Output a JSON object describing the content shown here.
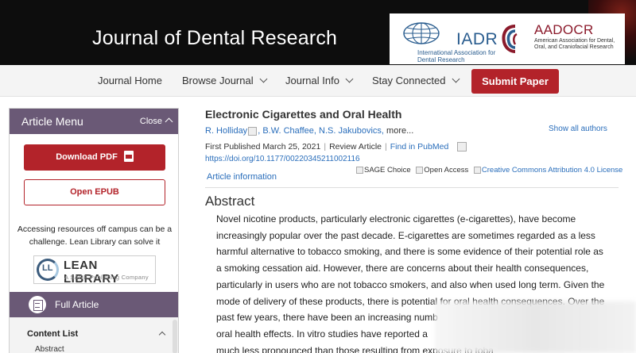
{
  "header": {
    "journal_title": "Journal of Dental Research",
    "iadr": {
      "name": "IADR",
      "subtitle": "International Association for Dental Research"
    },
    "aadocr": {
      "name": "AADOCR",
      "subtitle": "American Association for Dental, Oral, and Craniofacial Research"
    }
  },
  "nav": {
    "items": [
      {
        "label": "Journal Home"
      },
      {
        "label": "Browse Journal"
      },
      {
        "label": "Journal Info"
      },
      {
        "label": "Stay Connected"
      }
    ],
    "submit_label": "Submit Paper"
  },
  "sidebar": {
    "menu_title": "Article Menu",
    "close_label": "Close",
    "download_pdf": "Download PDF",
    "open_epub": "Open EPUB",
    "access_text": "Accessing resources off campus can be a challenge. Lean Library can solve it",
    "lean_library": {
      "name": "LEAN LIBRARY",
      "tagline": "A SAGE Publishing Company",
      "mark": "LL"
    },
    "full_article": "Full Article",
    "content_list": "Content List",
    "content_items": [
      "Abstract"
    ]
  },
  "article": {
    "title": "Electronic Cigarettes and Oral Health",
    "authors": [
      "R. Holliday",
      "B.W. Chaffee",
      "N.S. Jakubovics"
    ],
    "more": "more...",
    "show_all": "Show all authors",
    "published": "First Published March 25, 2021",
    "type": "Review Article",
    "pubmed": "Find in PubMed",
    "doi": "https://doi.org/10.1177/00220345211002116",
    "article_info": "Article information",
    "badges": {
      "sage_choice": "SAGE Choice",
      "open_access": "Open Access",
      "license": "Creative Commons Attribution 4.0 License"
    },
    "abstract_heading": "Abstract",
    "abstract_lines": [
      "Novel nicotine products, particularly electronic cigarettes (e-cigarettes), have become",
      "increasingly popular over the past decade. E-cigarettes are sometimes regarded as a less",
      "harmful alternative to tobacco smoking, and there is some evidence of their potential role as",
      "a smoking cessation aid. However, there are concerns about their health consequences,",
      "particularly in users who are not tobacco smokers, and also when used long term. Given the",
      "mode of delivery of these products, there is potential for oral health consequences. Over the",
      "past few years, there have been an increasing numb",
      "oral health effects. In vitro studies have reported a",
      "much less pronounced than those resulting from exposure to toba"
    ]
  },
  "colors": {
    "accent_red": "#b3232a",
    "menu_purple": "#6a5976",
    "link_blue": "#2a6ebb"
  }
}
